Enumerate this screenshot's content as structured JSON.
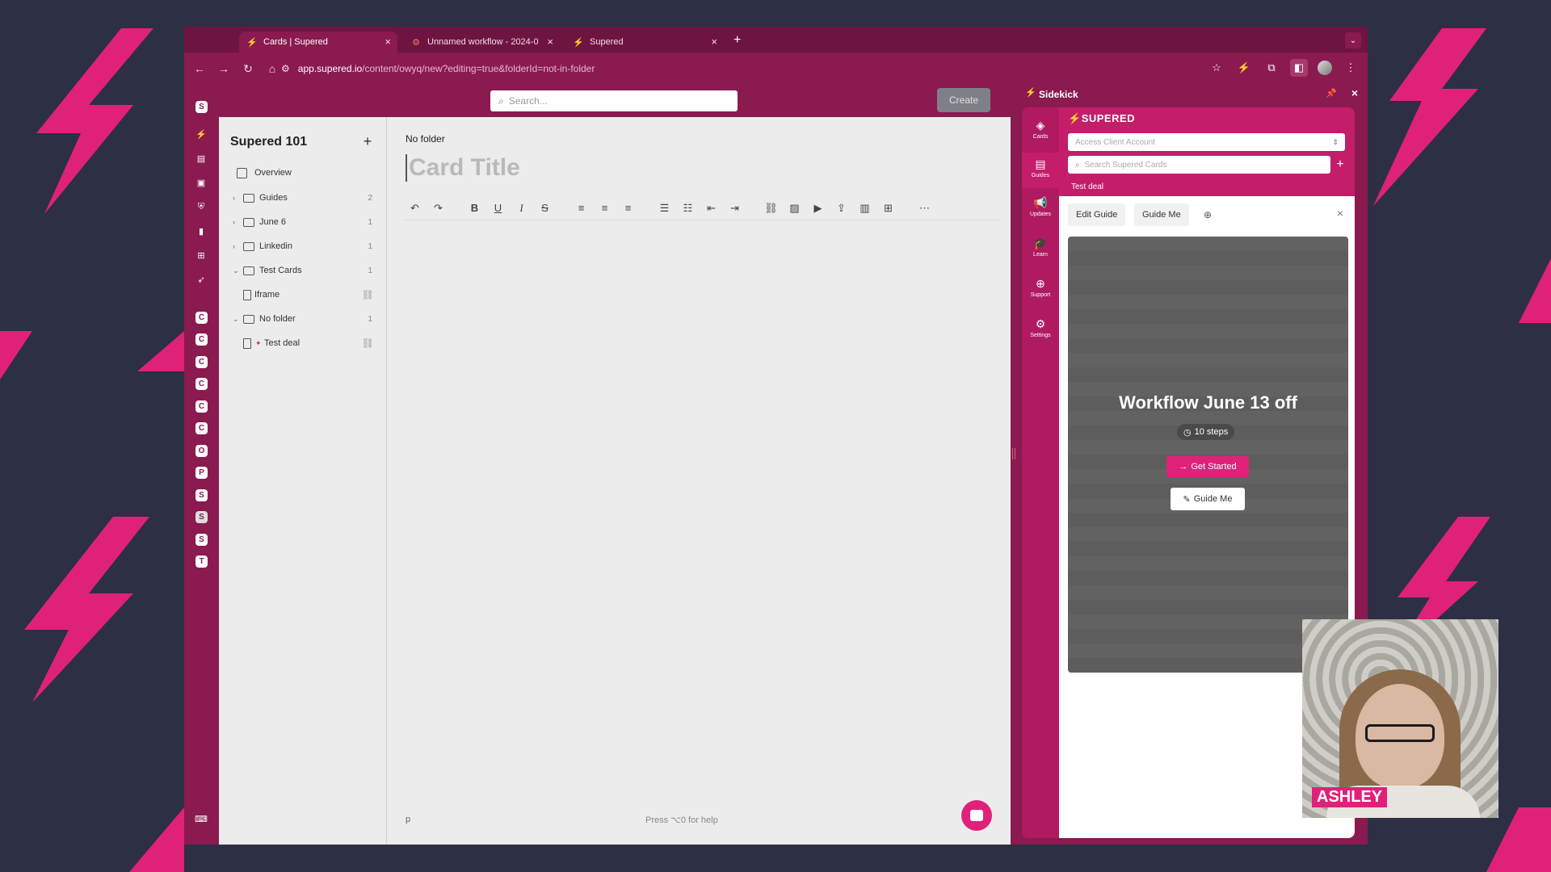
{
  "browser": {
    "tabs": [
      {
        "label": "Cards | Supered",
        "icon": "bolt-icon",
        "active": true
      },
      {
        "label": "Unnamed workflow - 2024-0",
        "icon": "hubspot-icon",
        "active": false
      },
      {
        "label": "Supered",
        "icon": "bolt-icon",
        "active": false
      }
    ],
    "url_host": "app.supered.io",
    "url_path": "/content/owyq/new?editing=true&folderId=not-in-folder"
  },
  "app": {
    "search_placeholder": "Search...",
    "create_label": "Create",
    "rail_letters": [
      "C",
      "C",
      "C",
      "C",
      "C",
      "C",
      "O",
      "P",
      "S",
      "S",
      "S",
      "T"
    ]
  },
  "sidebar": {
    "title": "Supered 101",
    "tree": [
      {
        "label": "Overview",
        "type": "overview",
        "count": ""
      },
      {
        "label": "Guides",
        "type": "folder",
        "count": "2"
      },
      {
        "label": "June 6",
        "type": "folder",
        "count": "1"
      },
      {
        "label": "Linkedin",
        "type": "folder",
        "count": "1"
      },
      {
        "label": "Test Cards",
        "type": "folder",
        "count": "1"
      },
      {
        "label": "Iframe",
        "type": "doc",
        "count": ""
      },
      {
        "label": "No folder",
        "type": "folder",
        "count": "1"
      },
      {
        "label": "Test deal",
        "type": "doc",
        "count": ""
      }
    ]
  },
  "editor": {
    "breadcrumb": "No folder",
    "title_placeholder": "Card Title",
    "footer_node": "p",
    "footer_help": "Press ⌥0 for help"
  },
  "sidekick": {
    "title": "Sidekick",
    "brand": "SUPERED",
    "nav": [
      {
        "label": "Cards",
        "icon": "layers-icon"
      },
      {
        "label": "Guides",
        "icon": "map-icon"
      },
      {
        "label": "Updates",
        "icon": "megaphone-icon"
      },
      {
        "label": "Learn",
        "icon": "graduation-cap-icon"
      },
      {
        "label": "Support",
        "icon": "lifebuoy-icon"
      },
      {
        "label": "Settings",
        "icon": "gear-icon"
      }
    ],
    "account_placeholder": "Access Client Account",
    "search_placeholder": "Search Supered Cards",
    "tag": "Test deal",
    "edit_guide": "Edit Guide",
    "guide_me_tab": "Guide Me",
    "guide_title": "Workflow June 13 off",
    "steps": "10 steps",
    "get_started": "Get Started",
    "guide_me": "Guide Me"
  },
  "webcam": {
    "name": "ASHLEY"
  },
  "colors": {
    "accent": "#e0217a",
    "chrome": "#8a1a4f",
    "background": "#2d2f45"
  }
}
